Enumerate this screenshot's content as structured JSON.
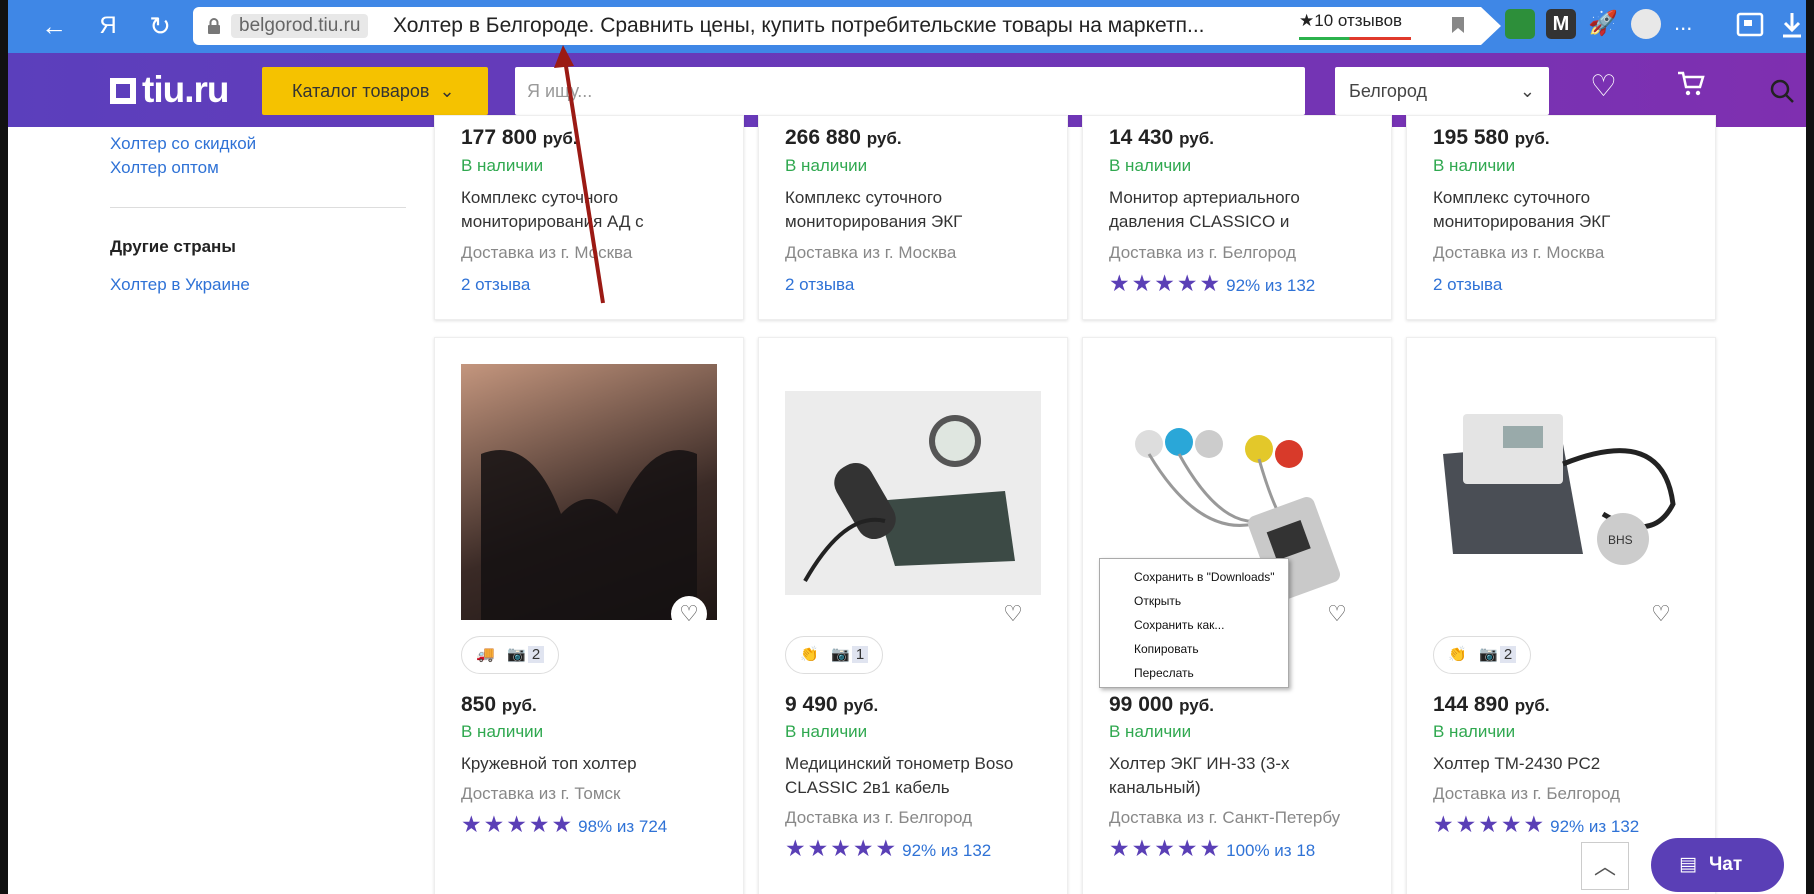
{
  "browser": {
    "back": "←",
    "yandex": "Я",
    "reload": "↻",
    "host": "belgorod.tiu.ru",
    "page_title": "Холтер в Белгороде. Сравнить цены, купить потребительские товары на маркетп...",
    "reviews": "★10 отзывов",
    "more": "..."
  },
  "site": {
    "logo": "tiu.ru",
    "catalog": "Каталог товаров",
    "search_placeholder": "Я ищу...",
    "city": "Белгород"
  },
  "sidebar": {
    "links": [
      "Холтер со скидкой",
      "Холтер оптом"
    ],
    "other_countries_title": "Другие страны",
    "other_links": [
      "Холтер в Украине"
    ]
  },
  "top_row": [
    {
      "price": "177 800",
      "currency": "руб.",
      "stock": "В наличии",
      "name": "Комплекс суточного мониторирования АД с",
      "delivery": "Доставка из г. Москва",
      "reviews": "2 отзыва"
    },
    {
      "price": "266 880",
      "currency": "руб.",
      "stock": "В наличии",
      "name": "Комплекс суточного мониторирования ЭКГ",
      "delivery": "Доставка из г. Москва",
      "reviews": "2 отзыва"
    },
    {
      "price": "14 430",
      "currency": "руб.",
      "stock": "В наличии",
      "name": "Монитор артериального давления CLASSICO и",
      "delivery": "Доставка из г. Белгород",
      "stars": "★★★★★",
      "rating": "92% из 132"
    },
    {
      "price": "195 580",
      "currency": "руб.",
      "stock": "В наличии",
      "name": "Комплекс суточного мониторирования ЭКГ",
      "delivery": "Доставка из г. Москва",
      "reviews": "2 отзыва"
    }
  ],
  "bottom_row": [
    {
      "badge_icon": "🚚",
      "photo_count": "2",
      "price": "850",
      "currency": "руб.",
      "stock": "В наличии",
      "name": "Кружевной топ холтер",
      "delivery": "Доставка из г. Томск",
      "stars": "★★★★★",
      "rating": "98% из 724"
    },
    {
      "badge_icon": "👏",
      "photo_count": "1",
      "price": "9 490",
      "currency": "руб.",
      "stock": "В наличии",
      "name": "Медицинский тонометр Boso CLASSIC 2в1 кабель",
      "delivery": "Доставка из г. Белгород",
      "stars": "★★★★★",
      "rating": "92% из 132"
    },
    {
      "price": "99 000",
      "currency": "руб.",
      "stock": "В наличии",
      "name": "Холтер ЭКГ ИН-33 (3-х канальный)",
      "delivery": "Доставка из г. Санкт-Петербу",
      "stars": "★★★★★",
      "rating": "100% из 18"
    },
    {
      "badge_icon": "👏",
      "photo_count": "2",
      "price": "144 890",
      "currency": "руб.",
      "stock": "В наличии",
      "name": "Холтер ТМ-2430 PC2",
      "delivery": "Доставка из г. Белгород",
      "stars": "★★★★★",
      "rating": "92% из 132"
    }
  ],
  "context_menu": [
    "Сохранить в \"Downloads\"",
    "Открыть",
    "Сохранить как...",
    "Копировать",
    "Переслать"
  ],
  "chat": "Чат",
  "colors": {
    "brand_purple": "#5a3fb6",
    "catalog_yellow": "#f5c200",
    "browser_blue": "#3f87e6",
    "stock_green": "#2fa84f",
    "link_blue": "#2f72d6"
  }
}
